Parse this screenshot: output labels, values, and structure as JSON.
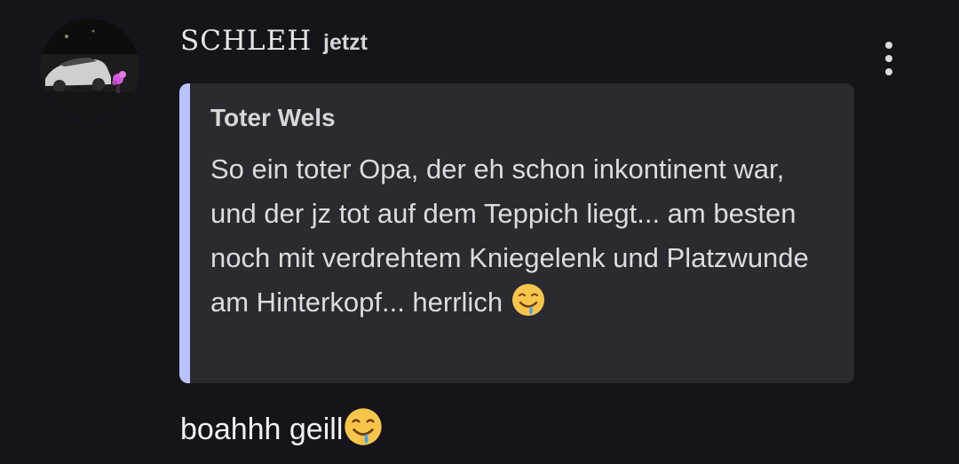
{
  "comment": {
    "author": "SCHLEH",
    "timestamp": "jetzt",
    "menu_icon": "more-vert-icon",
    "avatar_icon": "avatar-car-photo",
    "quote": {
      "author": "Toter Wels",
      "text": "So ein toter Opa, der eh schon inkontinent war, und der jz tot auf dem Teppich liegt... am besten noch mit verdrehtem Kniegelenk und Platzwunde am Hinterkopf... herrlich",
      "emoji": "drooling-face-emoji",
      "accent_color": "#b8c3ff"
    },
    "reply": {
      "text": "boahhh geill",
      "emoji": "drooling-face-emoji"
    }
  }
}
